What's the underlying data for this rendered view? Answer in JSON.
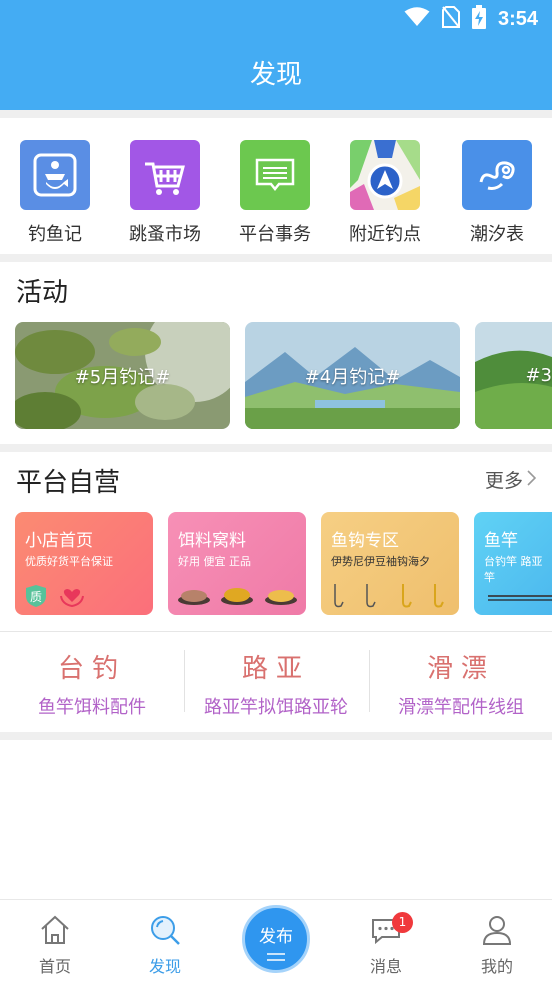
{
  "status_bar": {
    "time": "3:54"
  },
  "header": {
    "title": "发现"
  },
  "shortcuts": [
    {
      "label": "钓鱼记",
      "icon": "fishing-diary-icon",
      "color": "#5a8ee4"
    },
    {
      "label": "跳蚤市场",
      "icon": "shopping-basket-icon",
      "color": "#a257e6"
    },
    {
      "label": "平台事务",
      "icon": "message-note-icon",
      "color": "#6cc84f"
    },
    {
      "label": "附近钓点",
      "icon": "map-navigation-icon",
      "color": "#4a8ae6"
    },
    {
      "label": "潮汐表",
      "icon": "wave-icon",
      "color": "#4a90e8"
    }
  ],
  "activities": {
    "title": "活动",
    "cards": [
      {
        "caption": "#5月钓记#"
      },
      {
        "caption": "#4月钓记#"
      },
      {
        "caption": "#3"
      }
    ]
  },
  "store": {
    "title": "平台自营",
    "more_label": "更多",
    "cards": [
      {
        "title": "小店首页",
        "subtitle": "优质好货平台保证",
        "badge": "质",
        "color": "#fb7e74"
      },
      {
        "title": "饵料窝料",
        "subtitle": "好用 便宜 正品",
        "color": "#f37fb2"
      },
      {
        "title": "鱼钩专区",
        "subtitle": "伊势尼伊豆袖钩海夕",
        "color": "#efc26e"
      },
      {
        "title": "鱼竿",
        "subtitle": "台钓竿 路亚竿",
        "color": "#5cc7f1"
      }
    ]
  },
  "categories": [
    {
      "title": "台钓",
      "subtitle": "鱼竿饵料配件"
    },
    {
      "title": "路亚",
      "subtitle": "路亚竿拟饵路亚轮"
    },
    {
      "title": "滑漂",
      "subtitle": "滑漂竿配件线组"
    }
  ],
  "bottom_nav": {
    "items": [
      {
        "label": "首页",
        "icon": "home-icon"
      },
      {
        "label": "发现",
        "icon": "discover-icon"
      },
      {
        "label": "消息",
        "icon": "message-icon",
        "badge": "1"
      },
      {
        "label": "我的",
        "icon": "profile-icon"
      }
    ],
    "publish_label": "发布"
  }
}
